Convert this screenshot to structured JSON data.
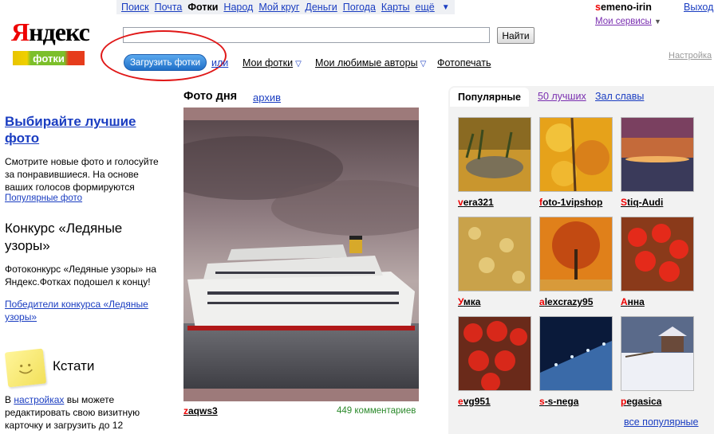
{
  "topnav": {
    "items": [
      {
        "label": "Поиск",
        "active": false
      },
      {
        "label": "Почта",
        "active": false
      },
      {
        "label": "Фотки",
        "active": true
      },
      {
        "label": "Народ",
        "active": false
      },
      {
        "label": "Мой круг",
        "active": false
      },
      {
        "label": "Деньги",
        "active": false
      },
      {
        "label": "Погода",
        "active": false
      },
      {
        "label": "Карты",
        "active": false
      },
      {
        "label": "ещё",
        "active": false
      }
    ]
  },
  "user": {
    "first_letter": "s",
    "rest": "emeno-irin",
    "exit": "Выход",
    "services": "Мои сервисы",
    "settings": "Настройка"
  },
  "logo": {
    "first_letter": "Я",
    "rest": "ндекс",
    "sub": "фотки"
  },
  "search": {
    "value": "",
    "button": "Найти"
  },
  "upload": {
    "button": "Загрузить фотки",
    "or": "или"
  },
  "menu": {
    "my_photos": "Мои фотки",
    "fav_authors": "Мои любимые авторы",
    "print": "Фотопечать"
  },
  "left": {
    "promo_title": "Выбирайте лучшие фото",
    "promo_text": "Смотрите новые фото и голосуйте за понравившиеся. На основе ваших голосов формируются",
    "promo_link": "Популярные фото",
    "contest_title": "Конкурс «Ледяные узоры»",
    "contest_text": "Фотоконкурс «Ледяные узоры» на Яндекс.Фотках подошел к концу!",
    "contest_link": "Победители конкурса «Ледяные узоры»",
    "kstati": "Кстати",
    "tip_pre": "В ",
    "tip_link": "настройках",
    "tip_post": " вы можете редактировать свою визитную карточку и загрузить до 12"
  },
  "pod": {
    "title": "Фото дня",
    "archive": "архив",
    "author_first": "z",
    "author_rest": "aqws3",
    "comments": "449 комментариев"
  },
  "tabs": {
    "popular": "Популярные",
    "best50": "50 лучших",
    "hall": "Зал славы"
  },
  "thumbs": [
    {
      "first": "v",
      "rest": "era321"
    },
    {
      "first": "f",
      "rest": "oto-1vipshop"
    },
    {
      "first": "S",
      "rest": "tiq-Audi"
    },
    {
      "first": "У",
      "rest": "мка"
    },
    {
      "first": "a",
      "rest": "lexcrazy95"
    },
    {
      "first": "А",
      "rest": "нна"
    },
    {
      "first": "e",
      "rest": "vg951"
    },
    {
      "first": "s",
      "rest": "-s-nega"
    },
    {
      "first": "p",
      "rest": "egasica"
    }
  ],
  "all_popular": "все популярные",
  "colors": {
    "link": "#1a3dc1",
    "accent_red": "#e00",
    "comments": "#2c8a2c"
  }
}
